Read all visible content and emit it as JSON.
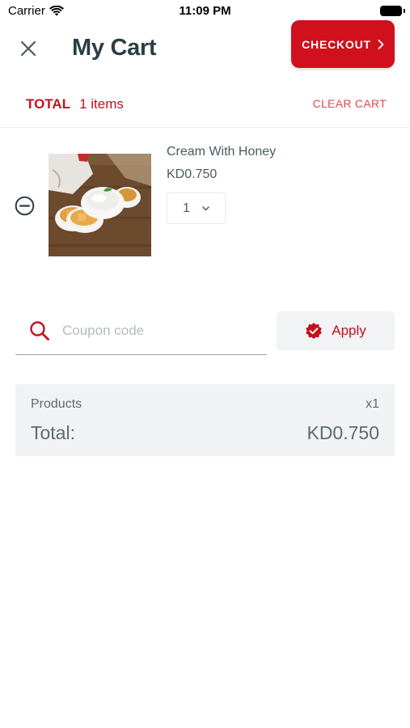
{
  "status_bar": {
    "carrier": "Carrier",
    "time": "11:09 PM"
  },
  "header": {
    "title": "My Cart",
    "checkout_label": "CHECKOUT"
  },
  "cart_summary": {
    "total_label": "TOTAL",
    "item_count": "1 items",
    "clear_label": "CLEAR CART"
  },
  "items": [
    {
      "name": "Cream With Honey",
      "price": "KD0.750",
      "quantity": "1"
    }
  ],
  "coupon": {
    "placeholder": "Coupon code",
    "apply_label": "Apply"
  },
  "summary": {
    "products_label": "Products",
    "products_count": "x1",
    "total_label": "Total:",
    "total_value": "KD0.750"
  },
  "colors": {
    "accent": "#d0101d",
    "text": "#34495e",
    "panel": "#f0f2f3"
  },
  "icons": [
    "wifi-icon",
    "battery-icon",
    "close-icon",
    "chevron-right-icon",
    "remove-circle-icon",
    "chevron-down-icon",
    "search-icon",
    "verified-badge-icon"
  ]
}
